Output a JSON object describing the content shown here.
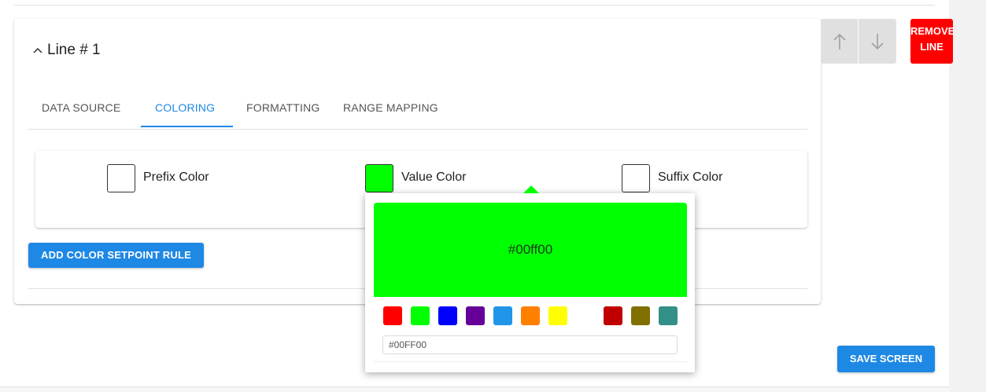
{
  "line_header": {
    "chevron": "^",
    "title": "Line # 1"
  },
  "tabs": [
    {
      "label": "DATA SOURCE"
    },
    {
      "label": "COLORING"
    },
    {
      "label": "FORMATTING"
    },
    {
      "label": "RANGE MAPPING"
    }
  ],
  "active_tab": "COLORING",
  "color_fields": {
    "prefix": {
      "label": "Prefix Color",
      "color": "#ffffff"
    },
    "value": {
      "label": "Value Color",
      "color": "#00ff00"
    },
    "suffix": {
      "label": "Suffix Color",
      "color": "#ffffff"
    }
  },
  "buttons": {
    "add_color_rule": "ADD COLOR SETPOINT RULE",
    "remove_line_1": "REMOVE",
    "remove_line_2": "LINE",
    "save_screen": "SAVE SCREEN",
    "move_up": "↑",
    "move_down": "↓"
  },
  "picker": {
    "preview_text": "#00ff00",
    "input_value": "#00FF00",
    "preset_colors": [
      "#ff0000",
      "#00ff00",
      "#0000ff",
      "#660099",
      "#2196e8",
      "#ff8000",
      "#ffff00",
      "#c00000",
      "#807000",
      "#339088"
    ]
  },
  "colors": {
    "accent": "#1e88e5",
    "danger": "#ff0000"
  }
}
